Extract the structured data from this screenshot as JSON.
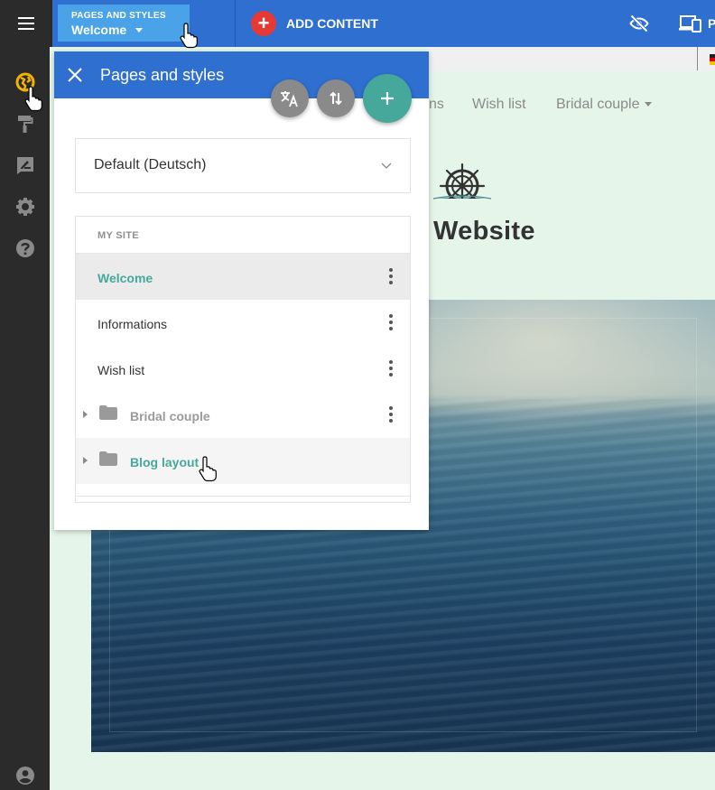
{
  "topbar": {
    "pages_button": {
      "small_label": "PAGES AND STYLES",
      "value": "Welcome"
    },
    "add_content": {
      "icon": "plus",
      "label": "ADD CONTENT"
    },
    "right_cut_label": "P"
  },
  "colors": {
    "topbar": "#2f6fd0",
    "accent": "#45a89a",
    "sidebar": "#2b2b2b",
    "add_button": "#e53935",
    "pages_button": "#4aa3e8"
  },
  "site": {
    "nav": [
      {
        "label": "ns"
      },
      {
        "label": "Wish list"
      },
      {
        "label": "Bridal couple",
        "has_dropdown": true
      }
    ],
    "title": "Website"
  },
  "panel": {
    "title": "Pages and styles",
    "style_select": {
      "value": "Default (Deutsch)"
    },
    "list": {
      "header": "MY SITE",
      "items": [
        {
          "label": "Welcome",
          "active": true,
          "menu": true
        },
        {
          "label": "Informations",
          "menu": true
        },
        {
          "label": "Wish list",
          "menu": true
        },
        {
          "label": "Bridal couple",
          "folder": true,
          "menu": true
        },
        {
          "label": "Blog layout",
          "folder": true,
          "menu": false
        }
      ]
    }
  }
}
